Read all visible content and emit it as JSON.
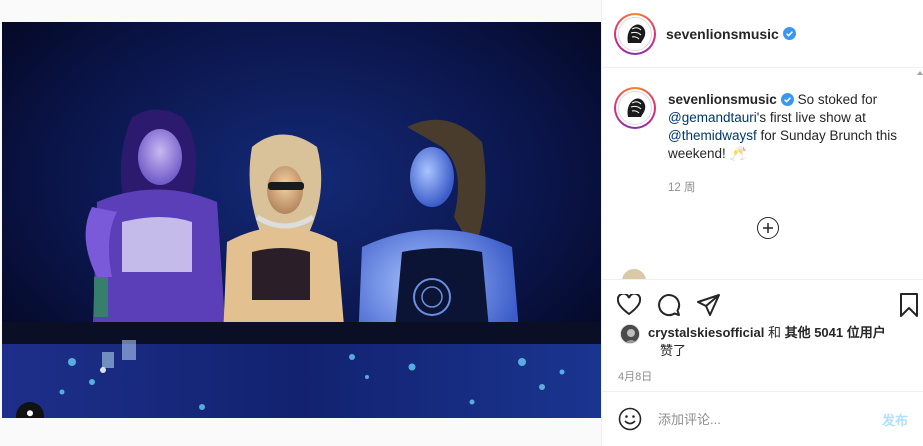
{
  "post": {
    "photo_alt": "DJ performance photo",
    "username": "sevenlionsmusic",
    "caption": {
      "username": "sevenlionsmusic",
      "text_1": " So stoked for ",
      "mention_1": "@gemandtauri",
      "text_2": "'s first live show at ",
      "mention_2": "@themidwaysf",
      "text_3": " for Sunday Brunch this weekend! 🥂",
      "time_ago": "12 周"
    },
    "likes": {
      "user": "crystalskiesofficial",
      "text_middle": " 和 ",
      "others": "其他 5041 位用户",
      "suffix": "赞了"
    },
    "date": "4月8日",
    "comment": {
      "placeholder": "添加评论...",
      "post_label": "发布"
    }
  },
  "colors": {
    "verified": "#3897f0",
    "mention": "#00376b",
    "post_button_disabled": "#b2dffc"
  },
  "icons": {
    "verified": "verified-badge-icon",
    "heart": "heart-icon",
    "comment": "comment-icon",
    "share": "share-icon",
    "save": "bookmark-icon",
    "emoji": "emoji-icon",
    "load_more": "plus-circle-icon",
    "tag": "user-tag-icon"
  }
}
